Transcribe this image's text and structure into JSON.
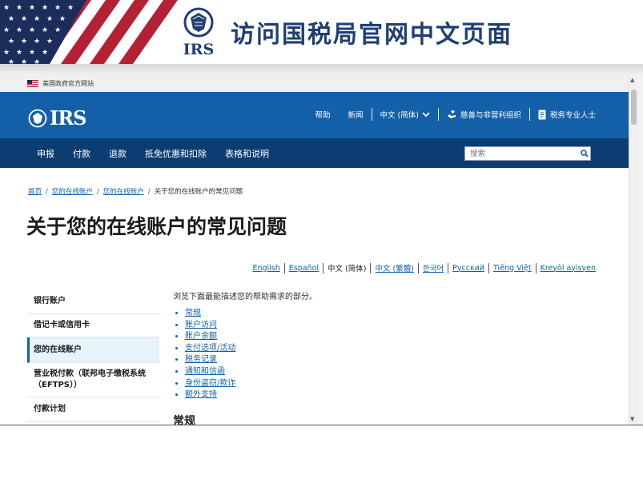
{
  "slide": {
    "title": "访问国税局官网中文页面",
    "logo_text": "IRS"
  },
  "banner": {
    "text": "美国政府官方网站"
  },
  "topbar": {
    "logo": "IRS",
    "links": [
      "帮助",
      "新闻",
      "中文 (简体)",
      "慈善与非营利组织",
      "税务专业人士"
    ]
  },
  "nav": {
    "items": [
      "申报",
      "付款",
      "退款",
      "抵免优惠和扣除",
      "表格和说明"
    ],
    "search_placeholder": "搜索"
  },
  "breadcrumb": {
    "items": [
      "首页",
      "您的在线账户",
      "您的在线账户",
      "关于您的在线账户的常见问题"
    ]
  },
  "page_title": "关于您的在线账户的常见问题",
  "languages": {
    "items": [
      "English",
      "Español",
      "中文 (简体)",
      "中文 (繁體)",
      "한국어",
      "Русский",
      "Tiếng Việt",
      "Kreyòl ayisyen"
    ],
    "current": "中文 (简体)"
  },
  "sidebar": {
    "items": [
      "银行账户",
      "借记卡或信用卡",
      "您的在线账户",
      "营业税付款（联邦电子缴税系统（EFTPS））",
      "付款计划"
    ],
    "active": "您的在线账户"
  },
  "content": {
    "intro": "浏览下面最能描述您的帮助需求的部分。",
    "links": [
      "常规",
      "账户访问",
      "账户余额",
      "支付选项/活动",
      "税务记录",
      "通知和信函",
      "身份盗窃/欺诈",
      "额外支持"
    ],
    "section_heading": "常规"
  },
  "colors": {
    "irs_blue": "#1460a8",
    "irs_navy": "#0b3d73",
    "title_blue": "#1f3e72"
  }
}
